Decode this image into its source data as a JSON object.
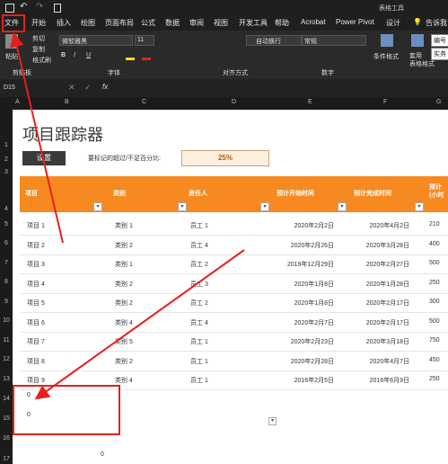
{
  "window": {
    "title": "表格工具"
  },
  "menu": [
    "文件",
    "开始",
    "插入",
    "绘图",
    "页面布局",
    "公式",
    "数据",
    "审阅",
    "视图",
    "开发工具",
    "帮助",
    "Acrobat",
    "Power Pivot",
    "设计",
    "告诉我"
  ],
  "ribbon": {
    "paste_label": "粘贴",
    "clipboard_items": [
      "剪切",
      "复制",
      "格式刷"
    ],
    "clipboard_group": "剪贴板",
    "font_name": "微软雅黑",
    "font_size": "11",
    "font_group": "字体",
    "align_group": "对齐方式",
    "wrap_label": "自动换行",
    "number_format": "常规",
    "number_group": "数字",
    "cond_format_label": "条件格式",
    "table_format_label": "套用\n表格格式",
    "style_cell_1": "编号",
    "style_cell_2": "实务"
  },
  "formula_bar": {
    "name_box": "D15",
    "fx": "fx"
  },
  "columns": [
    "A",
    "B",
    "C",
    "D",
    "E",
    "F",
    "G"
  ],
  "rows": [
    "1",
    "2",
    "3",
    "4",
    "5",
    "6",
    "7",
    "8",
    "9",
    "10",
    "11",
    "12",
    "13",
    "14",
    "15",
    "16",
    "17"
  ],
  "sheet": {
    "title": "项目跟踪器",
    "settings_button": "设置",
    "threshold_label": "要标记的超过/不足百分比:",
    "threshold_value": "25%",
    "headers": [
      "项目",
      "类别",
      "责任人",
      "预计开始时间",
      "预计完成时间",
      "预计\n(小时"
    ],
    "data": [
      [
        "项目 1",
        "类别 1",
        "员工 1",
        "2020年2月2日",
        "2020年4月2日",
        "210"
      ],
      [
        "项目 2",
        "类别 2",
        "员工 4",
        "2020年2月26日",
        "2020年3月28日",
        "400"
      ],
      [
        "项目 3",
        "类别 1",
        "员工 2",
        "2019年12月29日",
        "2020年2月27日",
        "500"
      ],
      [
        "项目 4",
        "类别 2",
        "员工 3",
        "2020年1月8日",
        "2020年1月28日",
        "250"
      ],
      [
        "项目 5",
        "类别 2",
        "员工 2",
        "2020年1月8日",
        "2020年2月17日",
        "300"
      ],
      [
        "项目 6",
        "类别 4",
        "员工 4",
        "2020年2月7日",
        "2020年2月17日",
        "500"
      ],
      [
        "项目 7",
        "类别 5",
        "员工 1",
        "2020年2月23日",
        "2020年3月18日",
        "750"
      ],
      [
        "项目 8",
        "类别 2",
        "员工 1",
        "2020年2月28日",
        "2020年4月7日",
        "450"
      ],
      [
        "项目 9",
        "类别 4",
        "员工 1",
        "2016年2月5日",
        "2016年6月9日",
        "250"
      ]
    ],
    "total_row_1": "0",
    "total_row_2": "0",
    "bottom_value": "0"
  },
  "annotation_color": "#e5201c"
}
